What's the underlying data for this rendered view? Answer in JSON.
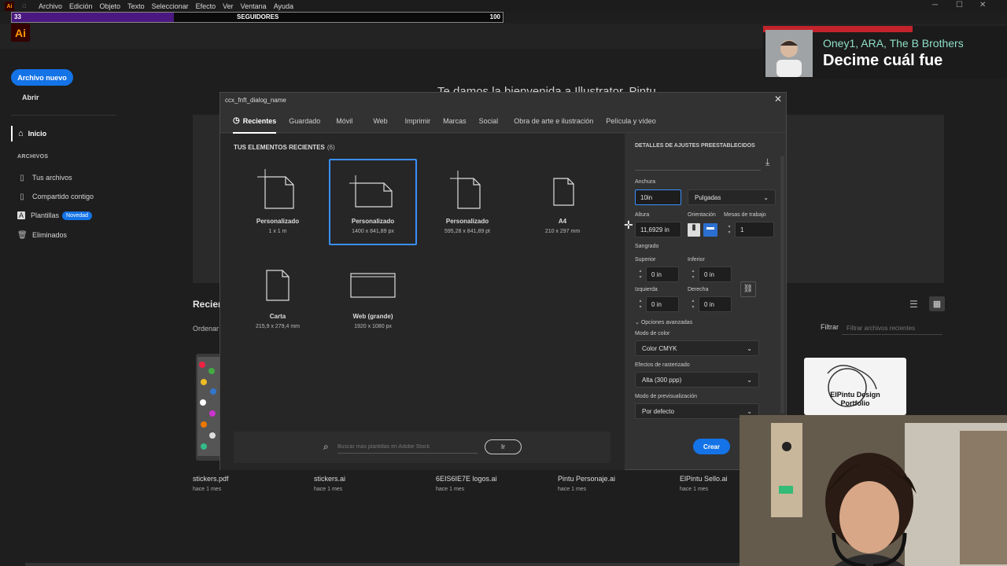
{
  "menubar": {
    "items": [
      "Archivo",
      "Edición",
      "Objeto",
      "Texto",
      "Seleccionar",
      "Efecto",
      "Ver",
      "Ventana",
      "Ayuda"
    ],
    "app_icon": "Ai"
  },
  "followers": {
    "current": "33",
    "label": "SEGUIDORES",
    "goal": "100",
    "progress": 0.33
  },
  "app": {
    "logo": "Ai"
  },
  "sidebar": {
    "new_label": "Archivo nuevo",
    "open_label": "Abrir",
    "home_label": "Inicio",
    "section_label": "ARCHIVOS",
    "items": [
      {
        "label": "Tus archivos",
        "icon": "file-icon"
      },
      {
        "label": "Compartido contigo",
        "icon": "shared-file-icon"
      },
      {
        "label": "Plantillas",
        "icon": "templates-icon",
        "badge": "Novedad"
      },
      {
        "label": "Eliminados",
        "icon": "trash-icon"
      }
    ]
  },
  "home": {
    "welcome": "Te damos la bienvenida a Illustrator, Pintu",
    "recent_heading": "Recient",
    "sort_label": "Ordenar",
    "filter_label": "Filtrar",
    "filter_placeholder": "Filtrar archivos recientes"
  },
  "files": [
    {
      "name": "stickers.pdf",
      "date": "hace 1 mes"
    },
    {
      "name": "stickers.ai",
      "date": "hace 1 mes"
    },
    {
      "name": "6EIS6IE7E logos.ai",
      "date": "hace 1 mes"
    },
    {
      "name": "Pintu Personaje.ai",
      "date": "hace 1 mes"
    },
    {
      "name": "ElPintu Sello.ai",
      "date": "hace 1 mes"
    }
  ],
  "thumb_text": {
    "line1": "ElPintu Design",
    "line2": "Portfolio"
  },
  "now_playing": {
    "artist": "Oney1, ARA, The B Brothers",
    "title": "Decime cuál fue"
  },
  "dialog": {
    "title": "ccx_fnft_dialog_name",
    "tabs": [
      "Recientes",
      "Guardado",
      "Móvil",
      "Web",
      "Imprimir",
      "Marcas",
      "Social",
      "Obra de arte e ilustración",
      "Película y vídeo"
    ],
    "recent_title": "TUS ELEMENTOS RECIENTES",
    "recent_count": "(6)",
    "presets": [
      {
        "name": "Personalizado",
        "size": "1 x 1 m"
      },
      {
        "name": "Personalizado",
        "size": "1400 x 841,89 px"
      },
      {
        "name": "Personalizado",
        "size": "595,28 x 841,89 pt"
      },
      {
        "name": "A4",
        "size": "210 x 297 mm"
      },
      {
        "name": "Carta",
        "size": "215,9 x 279,4 mm"
      },
      {
        "name": "Web (grande)",
        "size": "1920 x 1080 px"
      }
    ],
    "search_placeholder": "Buscar más plantillas en Adobe Stock",
    "go_label": "Ir",
    "details": {
      "heading": "DETALLES DE AJUSTES PREESTABLECIDOS",
      "width_label": "Anchura",
      "width_value": "10in",
      "units": "Pulgadas",
      "height_label": "Altura",
      "height_value": "11,6929 in",
      "orientation_label": "Orientación",
      "artboards_label": "Mesas de trabajo",
      "artboards_value": "1",
      "bleed_label": "Sangrado",
      "top_label": "Superior",
      "top_value": "0 in",
      "bottom_label": "Inferior",
      "bottom_value": "0 in",
      "left_label": "Izquierda",
      "left_value": "0 in",
      "right_label": "Derecha",
      "right_value": "0 in",
      "advanced_label": "Opciones avanzadas",
      "color_mode_label": "Modo de color",
      "color_mode_value": "Color CMYK",
      "raster_label": "Efectos de rasterizado",
      "raster_value": "Alta (300 ppp)",
      "preview_label": "Modo de previsualización",
      "preview_value": "Por defecto",
      "create_label": "Crear"
    }
  },
  "colors": {
    "accent": "#1473e6",
    "selection": "#3a8fff",
    "ai_orange": "#ff9a00",
    "progress": "#4a1880"
  }
}
